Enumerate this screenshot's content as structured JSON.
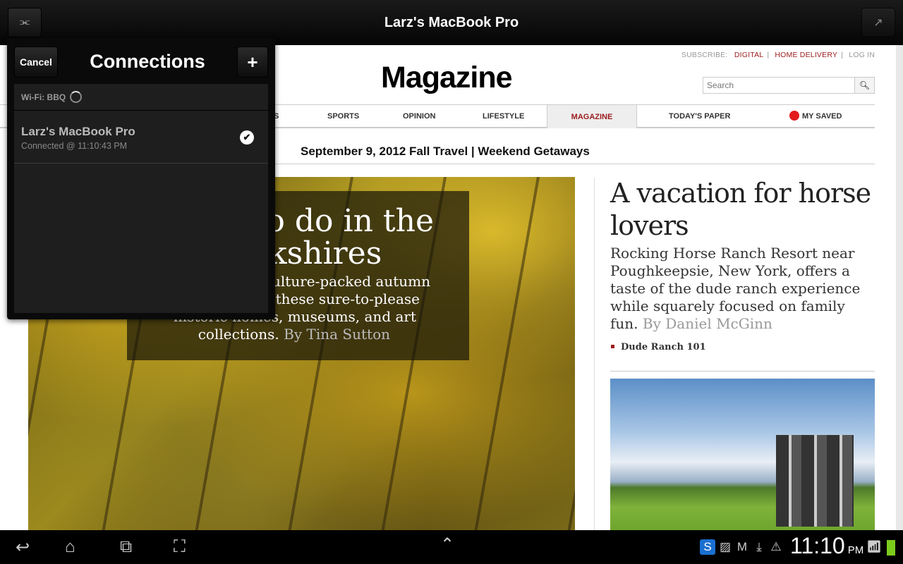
{
  "topbar": {
    "title": "Larz's MacBook Pro",
    "left_icon": "network-tree-icon",
    "right_icon": "share-icon"
  },
  "site": {
    "subscribe_label": "SUBSCRIBE:",
    "digital": "DIGITAL",
    "home_delivery": "HOME DELIVERY",
    "login": "LOG IN",
    "masthead": "Magazine",
    "search_placeholder": "Search",
    "nav": [
      "S",
      "SPORTS",
      "OPINION",
      "LIFESTYLE",
      "MAGAZINE",
      "TODAY'S PAPER",
      "MY SAVED"
    ],
    "active_nav": "MAGAZINE",
    "dateline": "September 9, 2012 Fall Travel | Weekend Getaways",
    "hero": {
      "headline_lines": [
        "to do in the",
        "kshires"
      ],
      "dek_lines": [
        "ulture-packed autumn",
        "these sure-to-please",
        "historic homes, museums, and art",
        "collections."
      ],
      "byline": "By Tina Sutton"
    },
    "side_story": {
      "title": "A vacation for horse lovers",
      "dek": "Rocking Horse Ranch Resort near Poughkeepsie, New York, offers a taste of the dude ranch experience while squarely focused on family fun.",
      "byline": "By Daniel McGinn",
      "link": "Dude Ranch 101"
    }
  },
  "popup": {
    "cancel": "Cancel",
    "title": "Connections",
    "add": "+",
    "wifi": "Wi-Fi: BBQ",
    "connections": [
      {
        "name": "Larz's MacBook Pro",
        "status": "Connected @ 11:10:43 PM",
        "selected": true
      }
    ]
  },
  "statusbar": {
    "time": "11:10",
    "ampm": "PM",
    "icons": [
      "skype-icon",
      "gallery-icon",
      "gmail-icon",
      "download-icon",
      "warning-icon",
      "wifi-icon",
      "battery-icon"
    ]
  },
  "colors": {
    "accent": "#9b1b1b",
    "saved_dot": "#e31b1b",
    "battery": "#7ccc1c"
  }
}
